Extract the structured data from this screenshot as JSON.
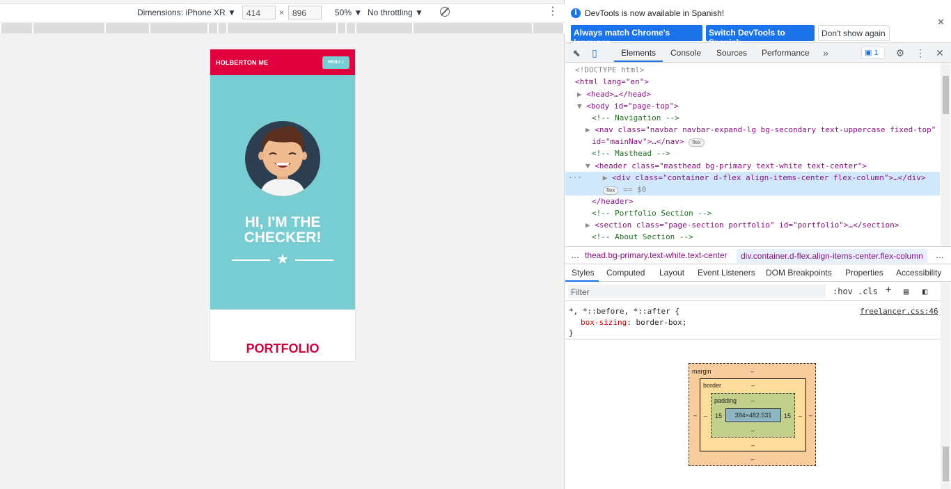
{
  "device_toolbar": {
    "dimensions_label": "Dimensions: iPhone XR ▼",
    "width_value": "414",
    "times": "×",
    "height_value": "896",
    "zoom": "50% ▼",
    "throttling": "No throttling ▼"
  },
  "site": {
    "brand": "HOLBERTON ME",
    "menu": "MENU ≡",
    "hello_line1": "HI, I'M THE",
    "hello_line2": "CHECKER!",
    "portfolio": "PORTFOLIO",
    "colors": {
      "nav": "#e0003e",
      "masthead": "#78cdd3",
      "portfolio": "#d1003c"
    }
  },
  "infobar": {
    "message": "DevTools is now available in Spanish!",
    "btn_match": "Always match Chrome's language",
    "btn_switch": "Switch DevTools to Spanish",
    "btn_dont": "Don't show again"
  },
  "tabs": [
    "Elements",
    "Console",
    "Sources",
    "Performance"
  ],
  "issues_count": "1",
  "dom_lines": [
    "<!DOCTYPE html>",
    "<html lang=\"en\">",
    "<head>…</head>",
    "<body id=\"page-top\">",
    "<!-- Navigation -->",
    "<nav class=\"navbar navbar-expand-lg bg-secondary text-uppercase fixed-top\"",
    "id=\"mainNav\">…</nav>",
    "<!-- Masthead -->",
    "<header class=\"masthead bg-primary text-white text-center\">",
    "<div class=\"container d-flex align-items-center flex-column\">…</div>",
    "== $0",
    "</header>",
    "<!-- Portfolio Section -->",
    "<section class=\"page-section portfolio\" id=\"portfolio\">…</section>",
    "<!-- About Section -->"
  ],
  "flex_badge": "flex",
  "breadcrumbs": {
    "more": "…",
    "c1": "thead.bg-primary.text-white.text-center",
    "c2": "div.container.d-flex.align-items-center.flex-column",
    "c3": "…"
  },
  "styles_tabs": [
    "Styles",
    "Computed",
    "Layout",
    "Event Listeners",
    "DOM Breakpoints",
    "Properties",
    "Accessibility"
  ],
  "filter_placeholder": "Filter",
  "filter_tools": {
    "hov": ":hov",
    "cls": ".cls",
    "plus": "+"
  },
  "rule": {
    "selector": "*, *::before, *::after {",
    "source": "freelancer.css:46",
    "prop": "box-sizing",
    "value": "border-box;",
    "close": "}"
  },
  "box_model": {
    "margin": "margin",
    "border": "border",
    "padding": "padding",
    "dash": "–",
    "pad_left": "15",
    "pad_right": "15",
    "content": "384×482.531"
  }
}
